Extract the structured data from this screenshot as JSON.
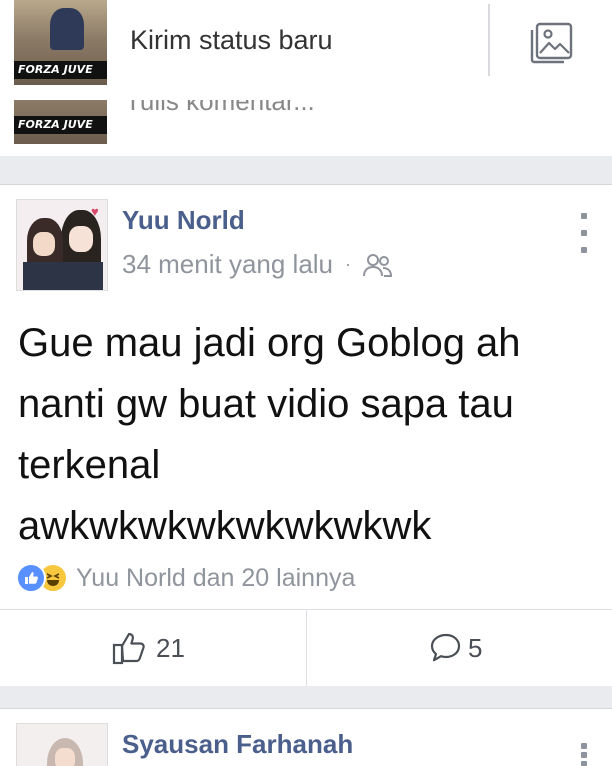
{
  "composer": {
    "avatar_watermark": "FORZA JUVE",
    "prompt": "Kirim status baru",
    "photo_icon": "photo-icon"
  },
  "comment": {
    "avatar_watermark": "FORZA JUVE",
    "placeholder": "Tulis komentar..."
  },
  "post": {
    "author": "Yuu Norld",
    "time": "34 menit yang lalu",
    "separator": "·",
    "privacy_icon": "friends-icon",
    "menu_icon": "more-vertical-icon",
    "text_lines": [
      "Gue mau jadi org Goblog ah",
      "nanti gw buat vidio sapa tau",
      "terkenal",
      "awkwkwkwkwkwkwkwk"
    ],
    "reactions": {
      "icons": [
        "like-reaction-icon",
        "haha-reaction-icon"
      ],
      "summary": "Yuu Norld dan 20 lainnya"
    },
    "actions": {
      "like_count": "21",
      "comment_count": "5"
    }
  },
  "next_post": {
    "author": "Syausan Farhanah"
  },
  "colors": {
    "link_blue": "#4b5f8c",
    "meta_gray": "#90949c",
    "feed_bg": "#e9ebee",
    "like_blue": "#5890ff",
    "haha_yellow": "#f7c83d"
  }
}
